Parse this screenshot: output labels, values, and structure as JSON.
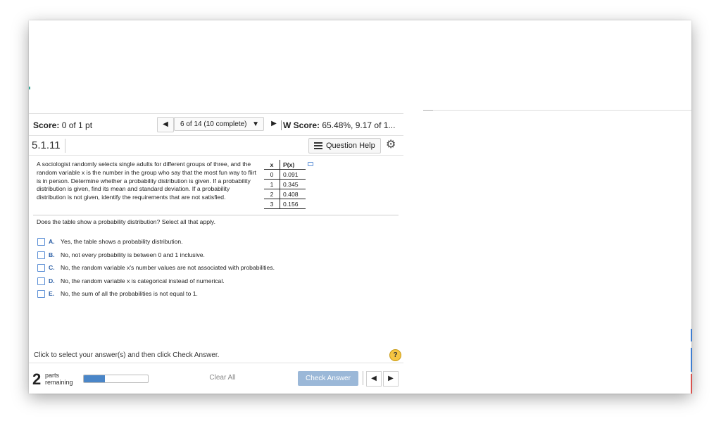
{
  "score": {
    "label": "Score:",
    "value": "0 of 1 pt"
  },
  "nav": {
    "prev": "◀",
    "progress": "6 of 14 (10 complete)",
    "dropdown": "▼",
    "next": "▶"
  },
  "hw": {
    "label": "W Score:",
    "value": "65.48%, 9.17 of 1..."
  },
  "question_id": "5.1.11",
  "question_help": "Question Help",
  "problem": "A sociologist randomly selects single adults for different groups of three, and the random variable x is the number in the group who say that the most fun way to flirt is in person. Determine whether a probability distribution is given. If a probability distribution is given, find its mean and standard deviation. If a probability distribution is not given, identify the requirements that are not satisfied.",
  "table": {
    "headers": [
      "x",
      "P(x)"
    ],
    "rows": [
      [
        "0",
        "0.091"
      ],
      [
        "1",
        "0.345"
      ],
      [
        "2",
        "0.408"
      ],
      [
        "3",
        "0.156"
      ]
    ]
  },
  "question": "Does the table show a probability distribution? Select all that apply.",
  "options": [
    {
      "letter": "A.",
      "text": "Yes, the table shows a probability distribution."
    },
    {
      "letter": "B.",
      "text": "No, not every probability is between 0 and 1 inclusive."
    },
    {
      "letter": "C.",
      "text": "No, the random variable x's number values are not associated with probabilities."
    },
    {
      "letter": "D.",
      "text": "No, the random variable x is categorical instead of numerical."
    },
    {
      "letter": "E.",
      "text": "No, the sum of all the probabilities is not equal to 1."
    }
  ],
  "instruction": "Click to select your answer(s) and then click Check Answer.",
  "help_symbol": "?",
  "parts": {
    "count": "2",
    "line1": "parts",
    "line2": "remaining",
    "progress": 0.33
  },
  "buttons": {
    "clear": "Clear All",
    "check": "Check Answer",
    "prev": "◀",
    "next": "▶"
  },
  "icons": {
    "gear": "⚙"
  },
  "colors": {
    "accent": "#2c5fa6",
    "check_button": "#9bb8d8",
    "progress_fill": "#4a86c8"
  }
}
